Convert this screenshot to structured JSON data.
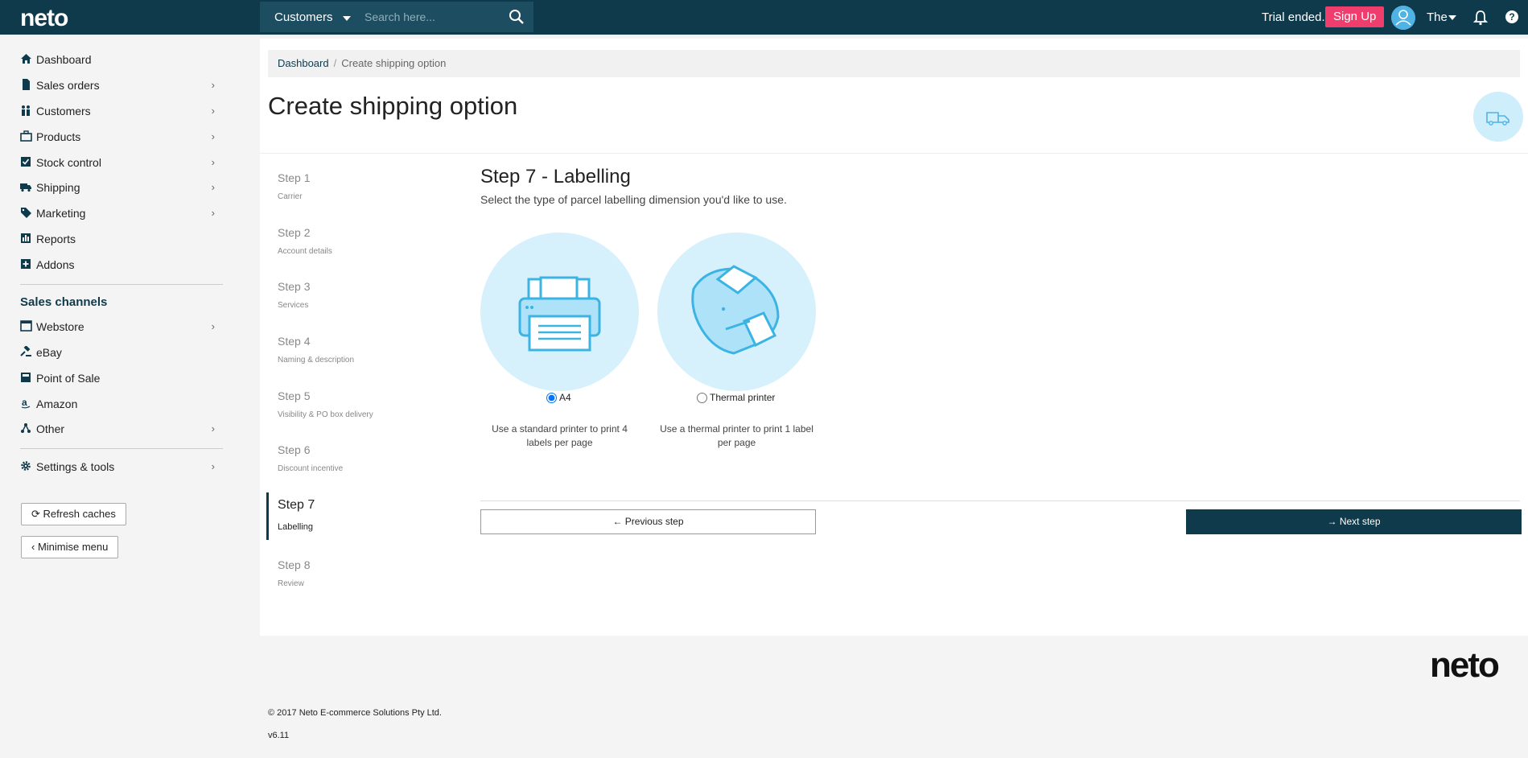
{
  "topbar": {
    "logo": "neto",
    "search_category": "Customers",
    "search_placeholder": "Search here...",
    "trial_text": "Trial ended.",
    "signup_label": "Sign Up",
    "user_name": "The",
    "help_label": "?"
  },
  "sidebar": {
    "items": [
      {
        "label": "Dashboard",
        "icon": "home-icon",
        "chevron": ""
      },
      {
        "label": "Sales orders",
        "icon": "document-icon",
        "chevron": "›"
      },
      {
        "label": "Customers",
        "icon": "people-icon",
        "chevron": "›"
      },
      {
        "label": "Products",
        "icon": "briefcase-icon",
        "chevron": "›"
      },
      {
        "label": "Stock control",
        "icon": "checkbox-icon",
        "chevron": "›"
      },
      {
        "label": "Shipping",
        "icon": "truck-icon",
        "chevron": "›"
      },
      {
        "label": "Marketing",
        "icon": "tag-icon",
        "chevron": "›"
      },
      {
        "label": "Reports",
        "icon": "bar-chart-icon",
        "chevron": ""
      },
      {
        "label": "Addons",
        "icon": "plus-square-icon",
        "chevron": ""
      }
    ],
    "channels_heading": "Sales channels",
    "channels": [
      {
        "label": "Webstore",
        "icon": "browser-icon",
        "chevron": "›"
      },
      {
        "label": "eBay",
        "icon": "gavel-icon",
        "chevron": ""
      },
      {
        "label": "Point of Sale",
        "icon": "register-icon",
        "chevron": ""
      },
      {
        "label": "Amazon",
        "icon": "amazon-icon",
        "chevron": ""
      },
      {
        "label": "Other",
        "icon": "share-icon",
        "chevron": "›"
      }
    ],
    "settings": {
      "label": "Settings & tools",
      "icon": "gear-icon",
      "chevron": "›"
    },
    "refresh_label": "⟳ Refresh caches",
    "minimise_label": "‹ Minimise menu"
  },
  "breadcrumb": {
    "home": "Dashboard",
    "separator": "/",
    "current": "Create shipping option"
  },
  "page_title": "Create shipping option",
  "steps": [
    {
      "num": "Step 1",
      "desc": "Carrier"
    },
    {
      "num": "Step 2",
      "desc": "Account details"
    },
    {
      "num": "Step 3",
      "desc": "Services"
    },
    {
      "num": "Step 4",
      "desc": "Naming & description"
    },
    {
      "num": "Step 5",
      "desc": "Visibility & PO box delivery"
    },
    {
      "num": "Step 6",
      "desc": "Discount incentive"
    },
    {
      "num": "Step 7",
      "desc": "Labelling"
    },
    {
      "num": "Step 8",
      "desc": "Review"
    }
  ],
  "content": {
    "title": "Step 7 - Labelling",
    "subtitle": "Select the type of parcel labelling dimension you'd like to use.",
    "options": [
      {
        "label": "A4",
        "desc": "Use a standard printer to print 4 labels per page",
        "selected": true,
        "icon": "printer-icon"
      },
      {
        "label": "Thermal printer",
        "desc": "Use a thermal printer to print 1 label per page",
        "selected": false,
        "icon": "thermal-printer-icon"
      }
    ],
    "prev_label": "← Previous step",
    "next_label": "→ Next step"
  },
  "footer": {
    "logo": "neto",
    "copyright": "© 2017 Neto E-commerce Solutions Pty Ltd.",
    "version": "v6.11"
  },
  "colors": {
    "topbar": "#0f3a4b",
    "accent": "#ef3e6e",
    "icon_light": "#d7f1fc",
    "icon_stroke": "#3bb3e3"
  }
}
